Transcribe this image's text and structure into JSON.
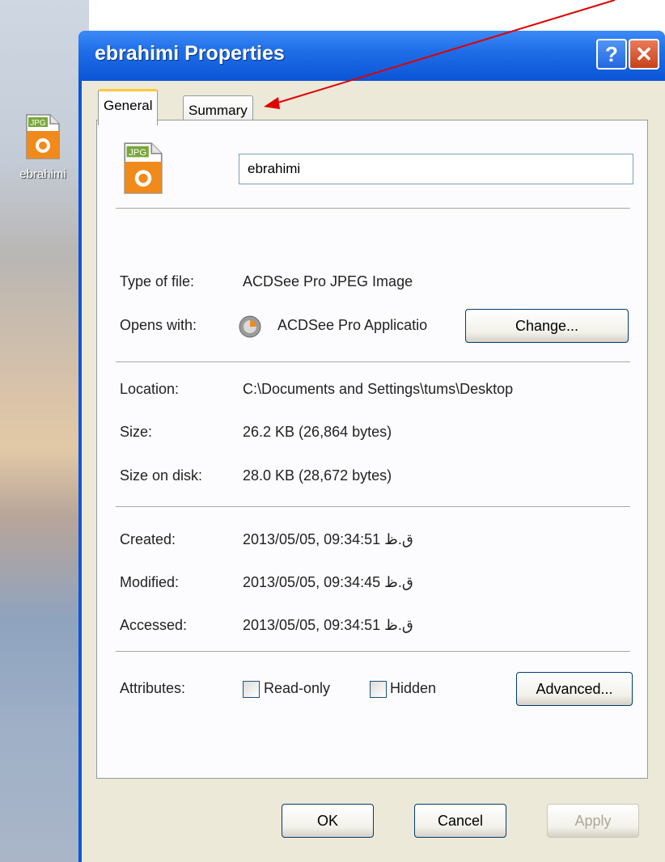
{
  "desktop": {
    "icon_badge": "JPG",
    "icon_label": "ebrahimi"
  },
  "window": {
    "title": "ebrahimi Properties",
    "help_label": "?",
    "close_label": "✕"
  },
  "tabs": [
    {
      "label": "General"
    },
    {
      "label": "Summary"
    }
  ],
  "general": {
    "file_icon_badge": "JPG",
    "file_name": "ebrahimi",
    "type_label": "Type of file:",
    "type_value": "ACDSee Pro JPEG Image",
    "opens_label": "Opens with:",
    "opens_value": "ACDSee Pro Applicatio",
    "change_label": "Change...",
    "location_label": "Location:",
    "location_value": "C:\\Documents and Settings\\tums\\Desktop",
    "size_label": "Size:",
    "size_value": "26.2 KB (26,864 bytes)",
    "size_disk_label": "Size on disk:",
    "size_disk_value": "28.0 KB (28,672 bytes)",
    "created_label": "Created:",
    "created_value": "2013/05/05, 09:34:51 ق.ظ",
    "modified_label": "Modified:",
    "modified_value": "2013/05/05, 09:34:45 ق.ظ",
    "accessed_label": "Accessed:",
    "accessed_value": "2013/05/05, 09:34:51 ق.ظ",
    "attributes_label": "Attributes:",
    "readonly_label": "Read-only",
    "hidden_label": "Hidden",
    "advanced_label": "Advanced..."
  },
  "buttons": {
    "ok": "OK",
    "cancel": "Cancel",
    "apply": "Apply"
  },
  "colors": {
    "titlebar": "#0b55d6",
    "annotation_arrow": "#e00000",
    "tab_highlight": "#ffc83c"
  }
}
